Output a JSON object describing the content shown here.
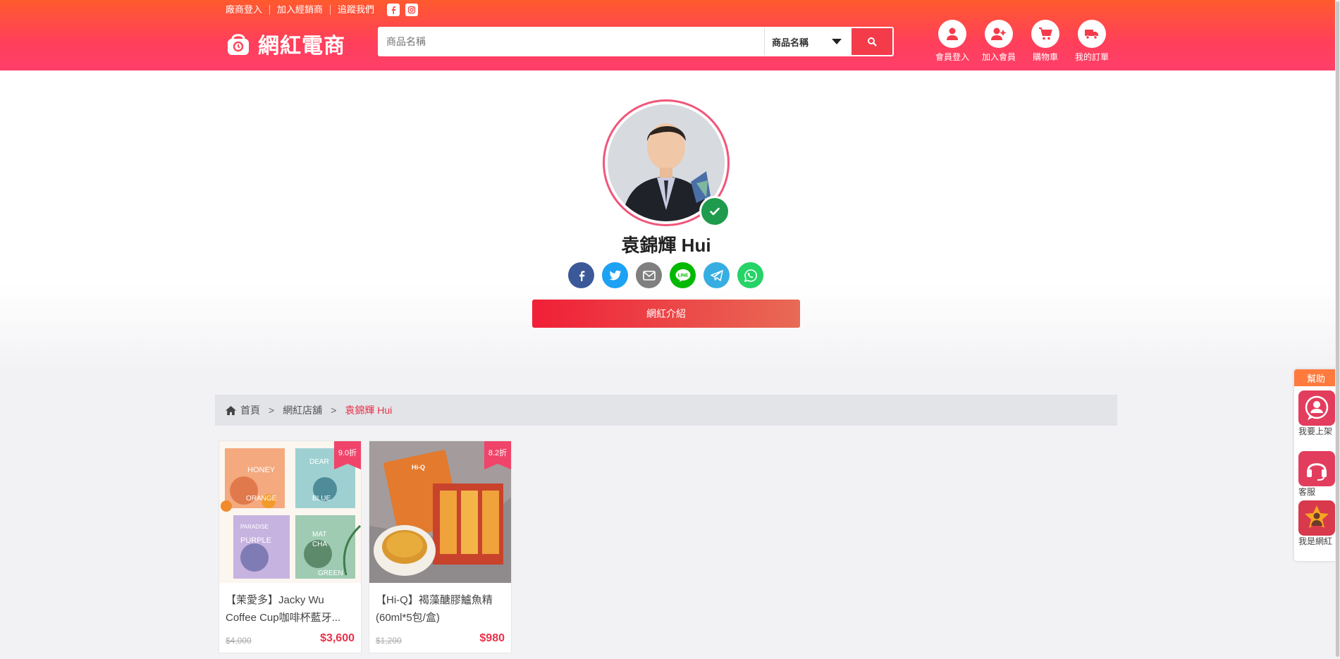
{
  "header": {
    "toplinks": [
      "廠商登入",
      "加入經銷商",
      "追蹤我們"
    ],
    "logo_text": "網紅電商",
    "search": {
      "placeholder": "商品名稱",
      "select_value": "商品名稱"
    },
    "icons": [
      {
        "label": "會員登入",
        "icon": "user-icon"
      },
      {
        "label": "加入會員",
        "icon": "user-plus-icon"
      },
      {
        "label": "購物車",
        "icon": "cart-icon"
      },
      {
        "label": "我的訂單",
        "icon": "truck-icon"
      }
    ]
  },
  "profile": {
    "name": "袁錦輝 Hui",
    "socials": [
      {
        "name": "facebook-icon",
        "color": "#3b5998"
      },
      {
        "name": "twitter-icon",
        "color": "#1da1f2"
      },
      {
        "name": "email-icon",
        "color": "#7f7f7f"
      },
      {
        "name": "line-icon",
        "color": "#00b900"
      },
      {
        "name": "telegram-icon",
        "color": "#37aee2"
      },
      {
        "name": "whatsapp-icon",
        "color": "#25d366"
      }
    ],
    "intro_label": "網紅介紹"
  },
  "breadcrumb": {
    "home": "首頁",
    "shops": "網紅店舖",
    "current": "袁錦輝 Hui"
  },
  "products": [
    {
      "badge": "9.0折",
      "title": "【茉愛多】Jacky Wu Coffee Cup咖啡杯藍牙...",
      "old_price": "$4,000",
      "price": "$3,600"
    },
    {
      "badge": "8.2折",
      "title": "【Hi-Q】褐藻醣膠鱸魚精(60ml*5包/盒)",
      "old_price": "$1,200",
      "price": "$980"
    }
  ],
  "product_image_text": {
    "p1": [
      "HONEY",
      "ORANGE",
      "DEAR",
      "BLUE",
      "PARADISE",
      "PURPLE",
      "MAT",
      "CHA",
      "GREEN"
    ],
    "p2": "Hi-Q"
  },
  "helpbar": {
    "title": "幫助",
    "items": [
      "我要上架",
      "客服",
      "我是網紅"
    ]
  }
}
